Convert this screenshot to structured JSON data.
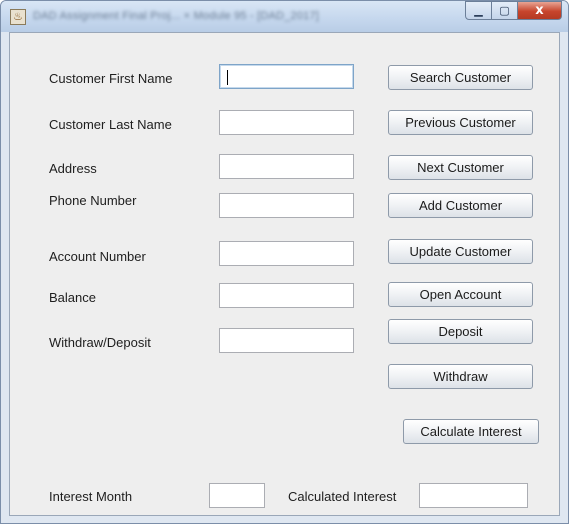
{
  "window": {
    "title": "DAD Assignment Final Proj...  ×  Module 95 - [DAD_2017]",
    "controls": {
      "minimize": "▁",
      "maximize": "▢",
      "close": "x"
    }
  },
  "app_icon": "♨",
  "form": {
    "first_name_label": "Customer First Name",
    "last_name_label": "Customer Last Name",
    "address_label": "Address",
    "phone_label": "Phone Number",
    "account_label": "Account Number",
    "balance_label": "Balance",
    "withdraw_deposit_label": "Withdraw/Deposit",
    "interest_month_label": "Interest Month",
    "calculated_interest_label": "Calculated Interest",
    "first_name_value": "",
    "last_name_value": "",
    "address_value": "",
    "phone_value": "",
    "account_value": "",
    "balance_value": "",
    "withdraw_deposit_value": "",
    "interest_month_value": "",
    "calculated_interest_value": ""
  },
  "buttons": {
    "search": "Search Customer",
    "previous": "Previous Customer",
    "next": "Next Customer",
    "add": "Add Customer",
    "update": "Update Customer",
    "open_account": "Open Account",
    "deposit": "Deposit",
    "withdraw": "Withdraw",
    "calculate_interest": "Calculate Interest"
  }
}
